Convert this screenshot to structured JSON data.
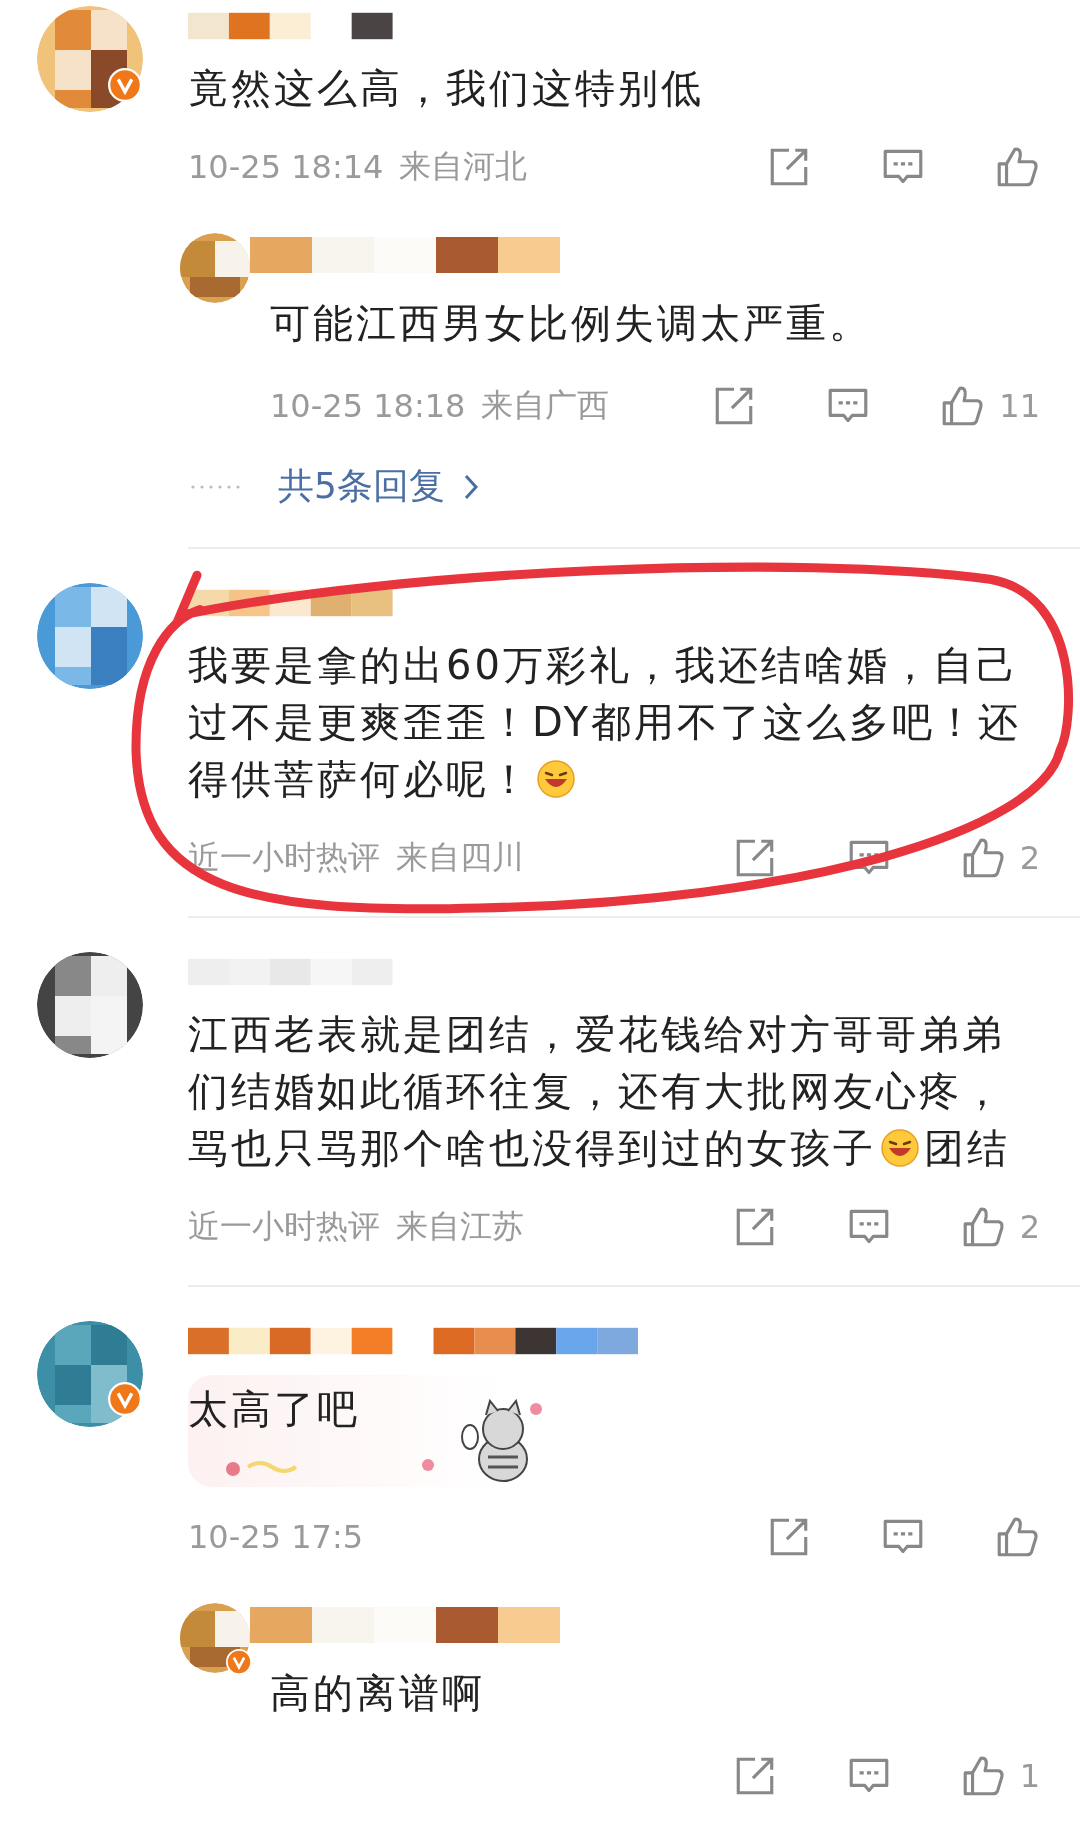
{
  "comments": [
    {
      "verified": true,
      "highlighted": false,
      "bubble": false,
      "text_parts": [
        {
          "kind": "text",
          "text": "竟然这么高，我们这特别低"
        }
      ],
      "time": "10-25 18:14",
      "location": "来自河北",
      "replies": [
        {
          "verified": false,
          "text_parts": [
            {
              "kind": "text",
              "text": "可能江西男女比例失调太严重。"
            }
          ],
          "time": "10-25 18:18",
          "location": "来自广西",
          "likes": "11"
        }
      ],
      "more_replies": "共5条回复"
    },
    {
      "verified": false,
      "highlighted": true,
      "bubble": false,
      "text_parts": [
        {
          "kind": "text",
          "text": "我要是拿的出60万彩礼，我还结啥婚，自己过不是更爽歪歪！DY都用不了这么多吧！还得供菩萨何必呢！"
        },
        {
          "kind": "emoji"
        }
      ],
      "time": "近一小时热评",
      "location": "来自四川",
      "likes": "2"
    },
    {
      "verified": false,
      "highlighted": false,
      "bubble": false,
      "text_parts": [
        {
          "kind": "text",
          "text": "江西老表就是团结，爱花钱给对方哥哥弟弟们结婚如此循环往复，还有大批网友心疼，骂也只骂那个啥也没得到过的女孩子"
        },
        {
          "kind": "emoji"
        },
        {
          "kind": "text",
          "text": "团结"
        }
      ],
      "time": "近一小时热评",
      "location": "来自江苏",
      "likes": "2"
    },
    {
      "verified": true,
      "highlighted": false,
      "bubble": true,
      "text_parts": [
        {
          "kind": "text",
          "text": "太高了吧"
        }
      ],
      "time": "10-25 17:5",
      "replies": [
        {
          "verified": true,
          "text_parts": [
            {
              "kind": "text",
              "text": "高的离谱啊"
            }
          ],
          "likes": "1"
        }
      ]
    }
  ]
}
